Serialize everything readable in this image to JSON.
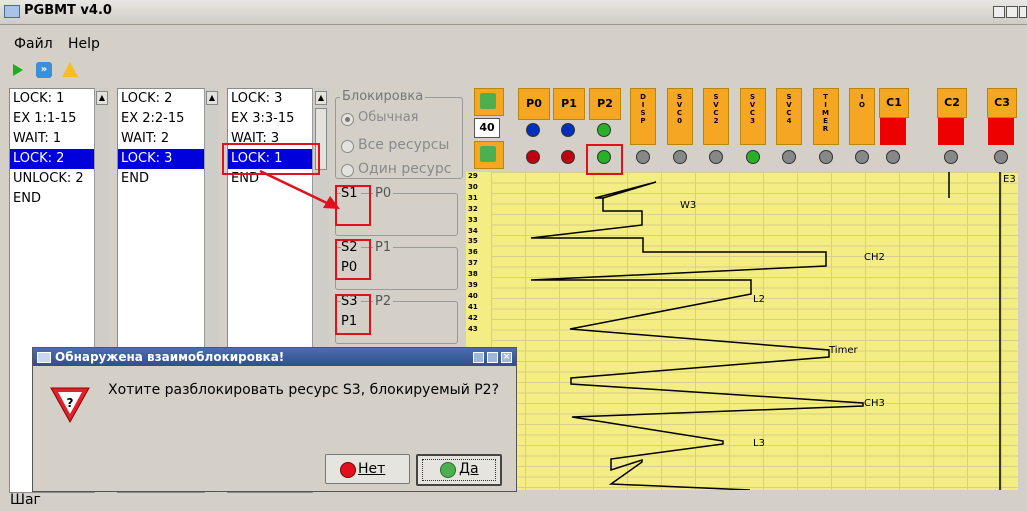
{
  "window": {
    "title": "PGBMT v4.0"
  },
  "menu": {
    "items": [
      "Файл",
      "Help"
    ]
  },
  "toolbar": {
    "icons": [
      "play-icon",
      "fast-forward-icon",
      "warning-icon"
    ]
  },
  "lists": [
    {
      "lines": [
        "LOCK: 1",
        "EX 1:1-15",
        "WAIT: 1",
        "LOCK: 2",
        "UNLOCK: 2",
        "END"
      ],
      "selected": 3
    },
    {
      "lines": [
        "LOCK: 2",
        "EX 2:2-15",
        "WAIT: 2",
        "LOCK: 3",
        "END"
      ],
      "selected": 3
    },
    {
      "lines": [
        "LOCK: 3",
        "EX 3:3-15",
        "WAIT: 3",
        "LOCK: 1",
        "END"
      ],
      "selected": 3
    }
  ],
  "blocking": {
    "group_label": "Блокировка",
    "options": [
      "Обычная",
      "Все ресурсы",
      "Один ресурс"
    ],
    "selected": 0
  },
  "resources": [
    {
      "name": "S1",
      "owner": "P0",
      "waiting": ""
    },
    {
      "name": "S2",
      "owner": "P1",
      "waiting": "P0"
    },
    {
      "name": "S3",
      "owner": "P2",
      "waiting": "P1"
    }
  ],
  "speed": {
    "value": "40"
  },
  "processes": [
    "P0",
    "P1",
    "P2"
  ],
  "system_columns": [
    "DISP",
    "SVC0",
    "SVC2",
    "SVC3",
    "SVC4",
    "TIMER",
    "IO"
  ],
  "channels": [
    "C1",
    "C2",
    "C3"
  ],
  "ruler": {
    "start": 29,
    "end": 43
  },
  "trace_labels": {
    "w3": "W3",
    "ch2": "CH2",
    "l2": "L2",
    "timer": "Timer",
    "ch3": "CH3",
    "l3": "L3",
    "e3": "E3"
  },
  "dialog": {
    "title": "Обнаружена взаимоблокировка!",
    "message": "Хотите разблокировать ресурс S3, блокируемый P2?",
    "no_label": "Нет",
    "yes_label": "Да"
  },
  "status": {
    "step_label": "Шаг"
  },
  "colors": {
    "grid": "#f4ed84",
    "header": "#f5a623",
    "highlight": "#e0101c",
    "selection": "#0000dd"
  }
}
